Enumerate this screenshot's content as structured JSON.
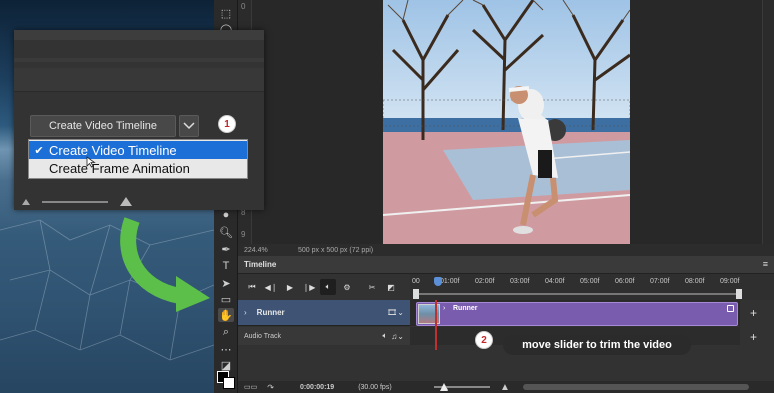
{
  "canvas": {
    "zoom": "224.4%",
    "doc_info": "500 px x 500 px (72 ppi)"
  },
  "vruler": [
    "0",
    "1",
    "2",
    "3",
    "4",
    "5",
    "6",
    "7",
    "8",
    "9"
  ],
  "dropdown": {
    "button_label": "Create Video Timeline",
    "menu": [
      {
        "label": "Create Video Timeline",
        "selected": true,
        "check": "✔"
      },
      {
        "label": "Create Frame Animation",
        "selected": false,
        "check": ""
      }
    ]
  },
  "annotations": {
    "step1": "1",
    "step2": "2",
    "trim_tip": "move slider to trim the video"
  },
  "timeline": {
    "title": "Timeline",
    "ticks": [
      "00",
      "01:00f",
      "02:00f",
      "03:00f",
      "04:00f",
      "05:00f",
      "06:00f",
      "07:00f",
      "08:00f",
      "09:00f"
    ],
    "track_name": "Runner",
    "clip_name": "Runner",
    "audio_track": "Audio Track",
    "current_time": "0:00:00:19",
    "fps": "(30.00 fps)",
    "add_label": "+"
  },
  "colors": {
    "clip": "#7a5cae",
    "selected_track": "#3f5474",
    "menu_highlight": "#1d6fd8",
    "arrow": "#5cbf4a"
  }
}
